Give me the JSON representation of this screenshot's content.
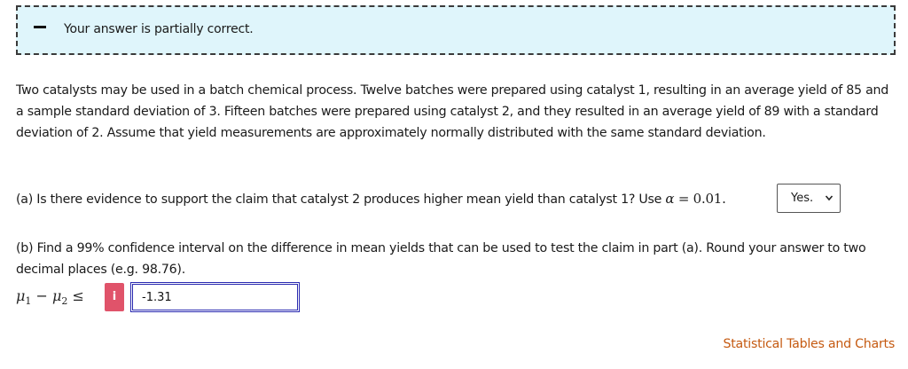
{
  "banner": {
    "icon": "minus-icon",
    "text": "Your answer is partially correct."
  },
  "problem": {
    "text": "Two catalysts may be used in a batch chemical process. Twelve batches were prepared using catalyst 1, resulting in an average yield of 85 and a sample standard deviation of 3. Fifteen batches were prepared using catalyst 2, and they resulted in an average yield of 89 with a standard deviation of 2. Assume that yield measurements are approximately normally distributed with the same standard deviation."
  },
  "part_a": {
    "question": "(a) Is there evidence to support the claim that catalyst 2 produces higher mean yield than catalyst 1? Use ",
    "alpha_symbol": "α",
    "equals": " = ",
    "alpha_value": "0.01",
    "period": ".",
    "selected_answer": "Yes."
  },
  "part_b": {
    "question": "(b) Find a 99% confidence interval on the difference in mean yields that can be used to test the claim in part (a). Round your answer to two decimal places (e.g. 98.76).",
    "mu": "μ",
    "sub1": "1",
    "minus": " − ",
    "sub2": "2",
    "leq": " ≤ ",
    "info_label": "i",
    "answer_value": "-1.31"
  },
  "footer": {
    "link_text": "Statistical Tables and Charts"
  },
  "colors": {
    "banner_bg": "#dff5fb",
    "info_badge": "#e0536a",
    "input_border": "#2a2ab0",
    "link": "#c55a11"
  }
}
